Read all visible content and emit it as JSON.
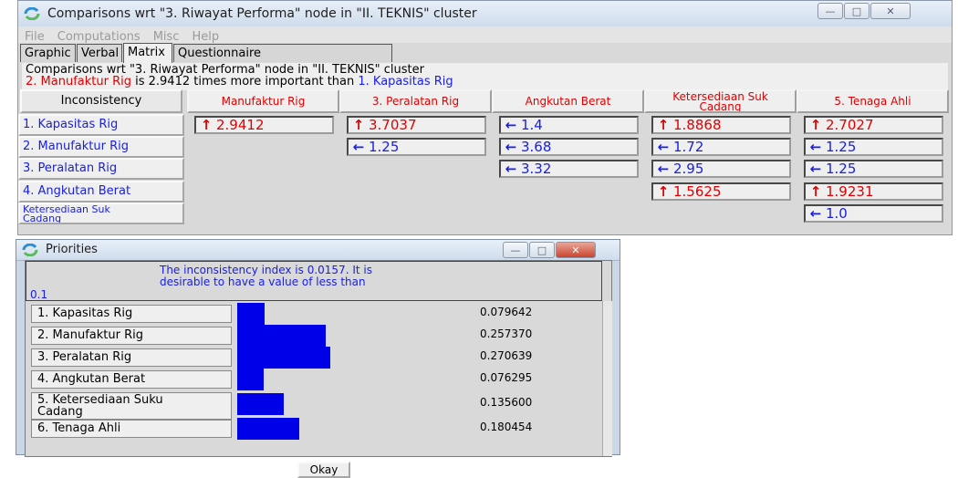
{
  "main_window": {
    "title": "Comparisons wrt \"3. Riwayat Performa\" node in \"II. TEKNIS\" cluster",
    "menu": [
      "File",
      "Computations",
      "Misc",
      "Help"
    ],
    "tabs": [
      "Graphic",
      "Verbal",
      "Matrix",
      "Questionnaire"
    ],
    "active_tab": "Matrix",
    "info_line1": "Comparisons wrt \"3. Riwayat Performa\" node in \"II. TEKNIS\" cluster",
    "info_line2": {
      "a": "2. Manufaktur Rig",
      "mid": " is 2.9412 times more important than ",
      "b": "1. Kapasitas Rig"
    },
    "inconsistency_button": "Inconsistency",
    "column_headers": [
      "Manufaktur Rig",
      "3. Peralatan Rig",
      "Angkutan Berat",
      "Ketersediaan Suku Cadang",
      "5. Tenaga Ahli"
    ],
    "column_header_lines": [
      [
        "Manufaktur Rig"
      ],
      [
        "3. Peralatan Rig"
      ],
      [
        "Angkutan Berat"
      ],
      [
        "Ketersediaan Suk",
        "Cadang"
      ],
      [
        "5. Tenaga Ahli"
      ]
    ],
    "row_headers": [
      {
        "lines": [
          "1. Kapasitas Rig"
        ]
      },
      {
        "lines": [
          "2. Manufaktur Rig"
        ]
      },
      {
        "lines": [
          "3. Peralatan Rig"
        ]
      },
      {
        "lines": [
          "4. Angkutan Berat"
        ]
      },
      {
        "lines": [
          "Ketersediaan Suk",
          "Cadang"
        ]
      }
    ],
    "matrix": [
      [
        {
          "dir": "up",
          "value": "2.9412"
        },
        {
          "dir": "up",
          "value": "3.7037"
        },
        {
          "dir": "left",
          "value": "1.4"
        },
        {
          "dir": "up",
          "value": "1.8868"
        },
        {
          "dir": "up",
          "value": "2.7027"
        }
      ],
      [
        null,
        {
          "dir": "left",
          "value": "1.25"
        },
        {
          "dir": "left",
          "value": "3.68"
        },
        {
          "dir": "left",
          "value": "1.72"
        },
        {
          "dir": "left",
          "value": "1.25"
        }
      ],
      [
        null,
        null,
        {
          "dir": "left",
          "value": "3.32"
        },
        {
          "dir": "left",
          "value": "2.95"
        },
        {
          "dir": "left",
          "value": "1.25"
        }
      ],
      [
        null,
        null,
        null,
        {
          "dir": "up",
          "value": "1.5625"
        },
        {
          "dir": "up",
          "value": "1.9231"
        }
      ],
      [
        null,
        null,
        null,
        null,
        {
          "dir": "left",
          "value": "1.0"
        }
      ]
    ]
  },
  "priorities_window": {
    "title": "Priorities",
    "note": "The inconsistency index is 0.0157.  It is desirable to have a value of less than",
    "note_tail": "0.1",
    "items": [
      {
        "lines": [
          "1. Kapasitas Rig"
        ],
        "value": "0.079642",
        "priority": 0.079642
      },
      {
        "lines": [
          "2. Manufaktur Rig"
        ],
        "value": "0.257370",
        "priority": 0.25737
      },
      {
        "lines": [
          "3. Peralatan Rig"
        ],
        "value": "0.270639",
        "priority": 0.270639
      },
      {
        "lines": [
          "4. Angkutan Berat"
        ],
        "value": "0.076295",
        "priority": 0.076295
      },
      {
        "lines": [
          "5. Ketersediaan Suku",
          "Cadang"
        ],
        "value": "0.135600",
        "priority": 0.1356
      },
      {
        "lines": [
          "6. Tenaga Ahli"
        ],
        "value": "0.180454",
        "priority": 0.180454
      }
    ],
    "okay_button": "Okay",
    "bar_color": "#0000e8"
  },
  "colors": {
    "red": "#e00000",
    "blue": "#1a20e0"
  },
  "icons": {
    "up": "red-up-arrow-icon",
    "left": "blue-left-arrow-icon"
  }
}
